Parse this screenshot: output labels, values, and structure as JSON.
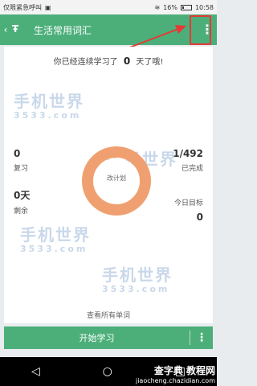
{
  "status": {
    "left_text": "仅限紧急呼叫",
    "battery": "16%",
    "time": "10:58"
  },
  "appbar": {
    "back_icon": "chevron-left-icon",
    "logo_text": "Ŧ",
    "title": "生活常用词汇",
    "menu_icon": "more-vert-icon"
  },
  "card": {
    "streak_prefix": "你已经连续学习了",
    "streak_days": "0",
    "streak_suffix": "天了哦!",
    "review_count": "0",
    "review_label": "复习",
    "remaining_days": "0天",
    "remaining_label": "剩余",
    "completed_value": "1/492",
    "completed_label": "已完成",
    "goal_label": "今日目标",
    "goal_value": "0",
    "donut_label": "改计划",
    "view_all": "查看所有单词"
  },
  "watermark": {
    "brand": "手机世界",
    "site": "3533.com"
  },
  "bottom": {
    "start_button": "开始学习",
    "more_icon": "more-vert-icon"
  },
  "footer_watermark": {
    "line1": "查字典 教程网",
    "line2": "jiaocheng.chazidian.com"
  },
  "colors": {
    "accent": "#4caf7a",
    "donut": "#f0a070",
    "highlight": "#e53935"
  }
}
